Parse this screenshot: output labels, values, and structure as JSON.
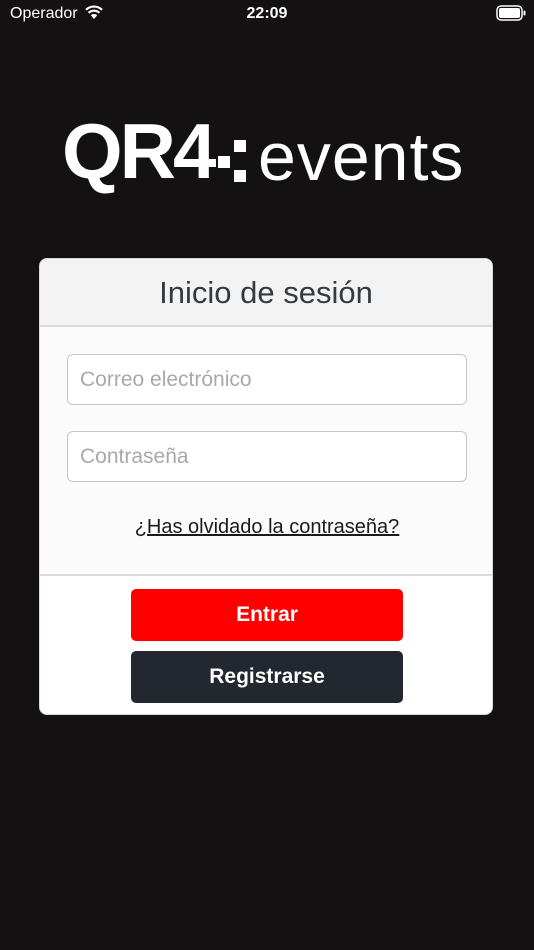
{
  "status_bar": {
    "carrier": "Operador",
    "time": "22:09"
  },
  "logo": {
    "qr": "QR4",
    "events": "events"
  },
  "login": {
    "title": "Inicio de sesión",
    "email_placeholder": "Correo electrónico",
    "password_placeholder": "Contraseña",
    "forgot_link": "¿Has olvidado la contraseña?",
    "login_button": "Entrar",
    "register_button": "Registrarse"
  },
  "colors": {
    "background": "#141112",
    "primary_button": "#ff0000",
    "secondary_button": "#23272f"
  }
}
